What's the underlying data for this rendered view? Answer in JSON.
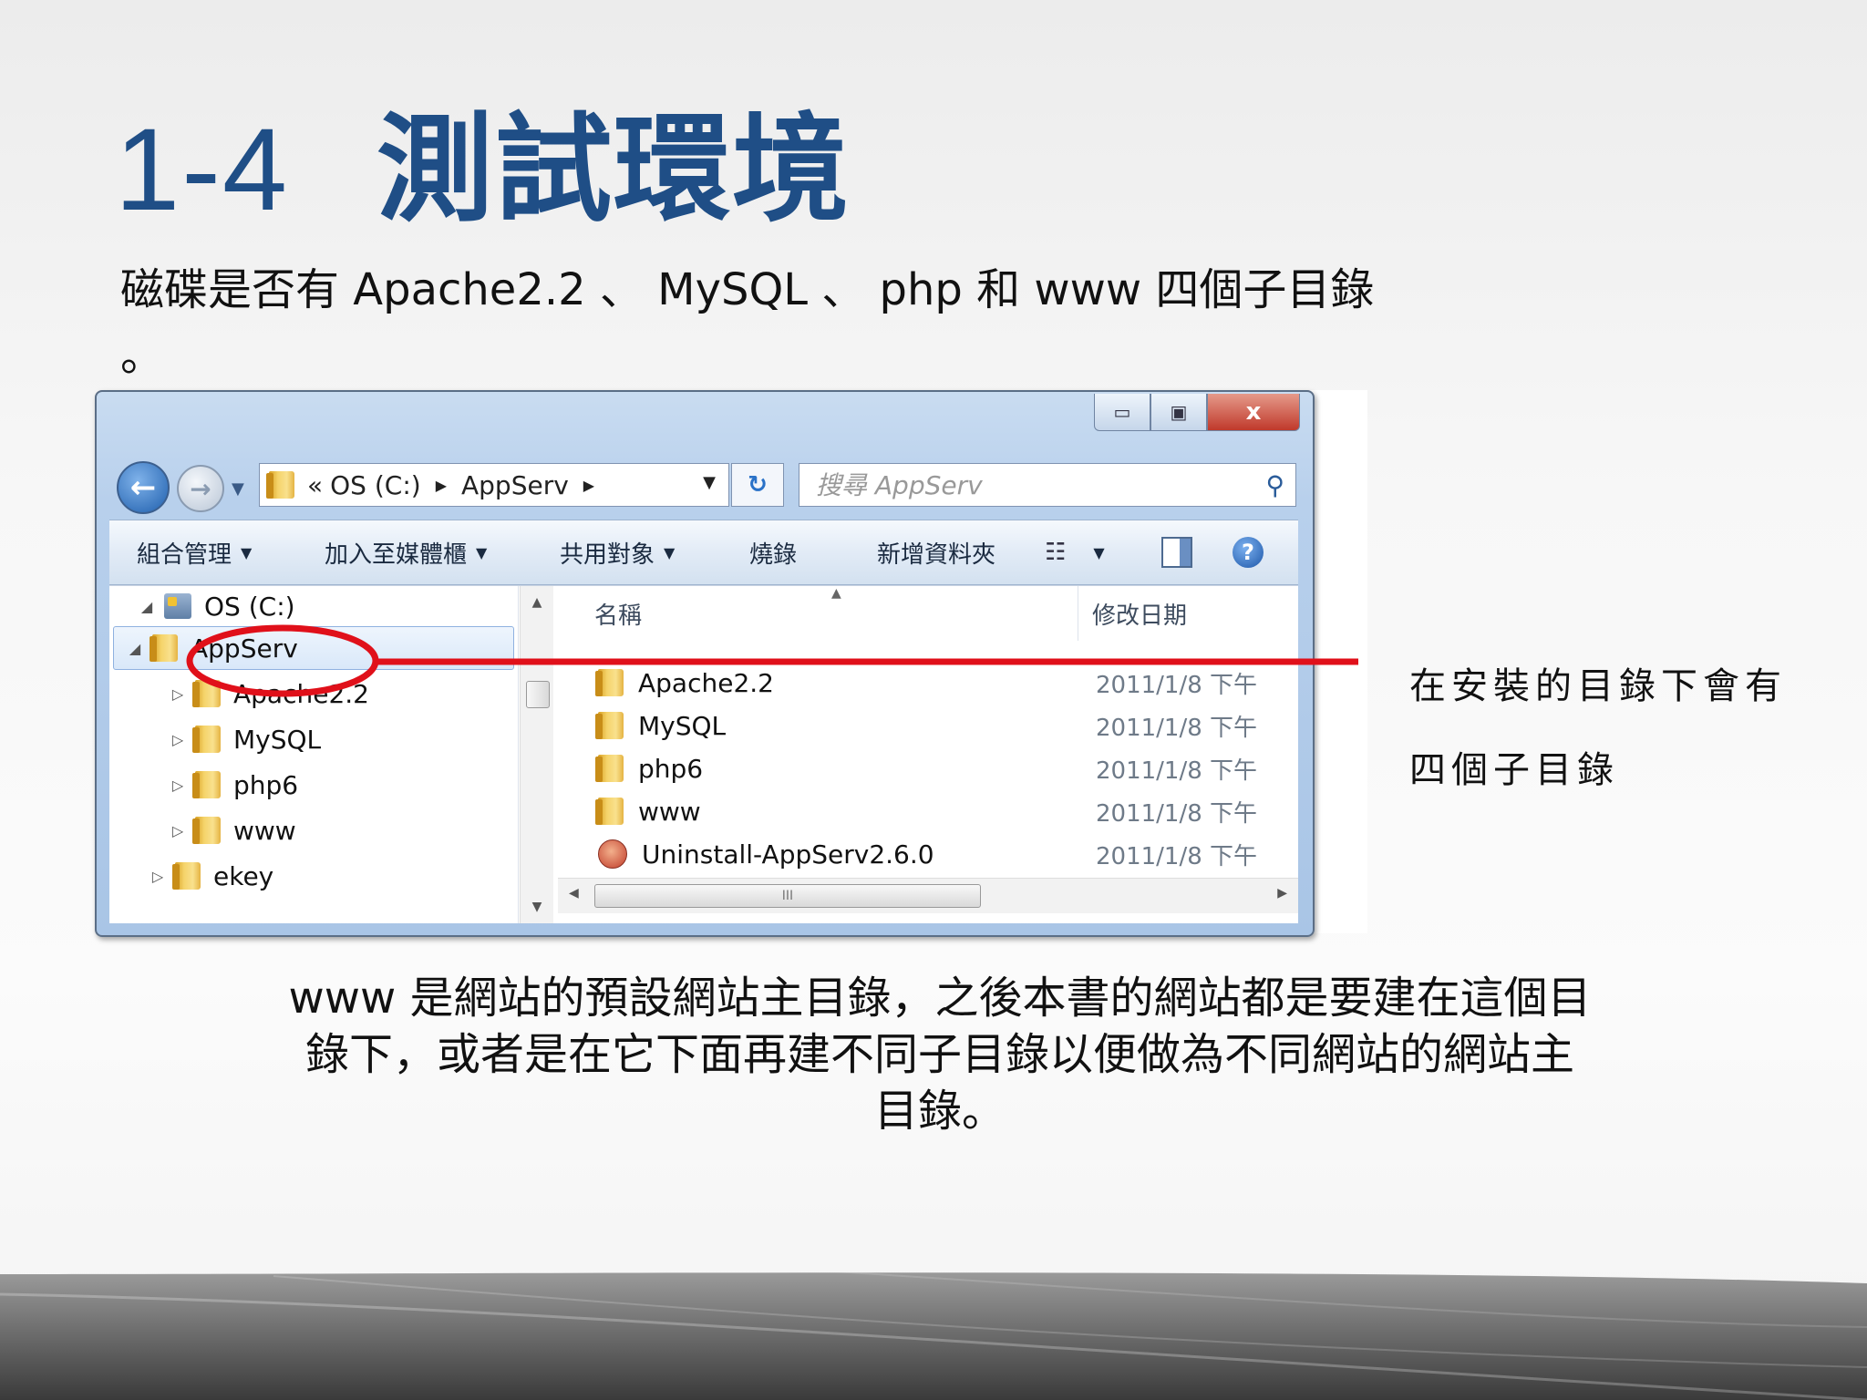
{
  "slide": {
    "number": "1-4",
    "title": "測試環境",
    "intro": "磁碟是否有 Apache2.2 、 MySQL 、 php 和 www 四個子目錄",
    "intro_cont": "。",
    "callout_line1": "在安裝的目錄下會有",
    "callout_line2": "四個子目錄",
    "footer": "www 是網站的預設網站主目錄，之後本書的網站都是要建在這個目錄下，或者是在它下面再建不同子目錄以便做為不同網站的網站主目錄。"
  },
  "window": {
    "controls": {
      "minimize": "▭",
      "maximize": "▣",
      "close": "x"
    },
    "address": {
      "prefix": "«",
      "crumbs": [
        "OS (C:)",
        "AppServ"
      ]
    },
    "search": {
      "placeholder": "搜尋 AppServ"
    },
    "toolbar": {
      "organize": "組合管理",
      "add_to_library": "加入至媒體櫃",
      "share_with": "共用對象",
      "burn": "燒錄",
      "new_folder": "新增資料夾"
    },
    "tree": [
      {
        "label": "OS (C:)"
      },
      {
        "label": "AppServ"
      },
      {
        "label": "Apache2.2"
      },
      {
        "label": "MySQL"
      },
      {
        "label": "php6"
      },
      {
        "label": "www"
      },
      {
        "label": "ekey"
      }
    ],
    "columns": {
      "name": "名稱",
      "date": "修改日期"
    },
    "files": [
      {
        "name": "Apache2.2",
        "date": "2011/1/8 下午"
      },
      {
        "name": "MySQL",
        "date": "2011/1/8 下午"
      },
      {
        "name": "php6",
        "date": "2011/1/8 下午"
      },
      {
        "name": "www",
        "date": "2011/1/8 下午"
      },
      {
        "name": "Uninstall-AppServ2.6.0",
        "date": "2011/1/8 下午"
      }
    ]
  },
  "colors": {
    "title": "#1f4e86",
    "highlight": "#e0101a"
  },
  "icons": [
    "back-arrow-icon",
    "forward-arrow-icon",
    "folder-icon",
    "refresh-icon",
    "search-icon",
    "view-options-icon",
    "preview-pane-icon",
    "help-icon",
    "drive-icon",
    "uninstall-icon"
  ]
}
